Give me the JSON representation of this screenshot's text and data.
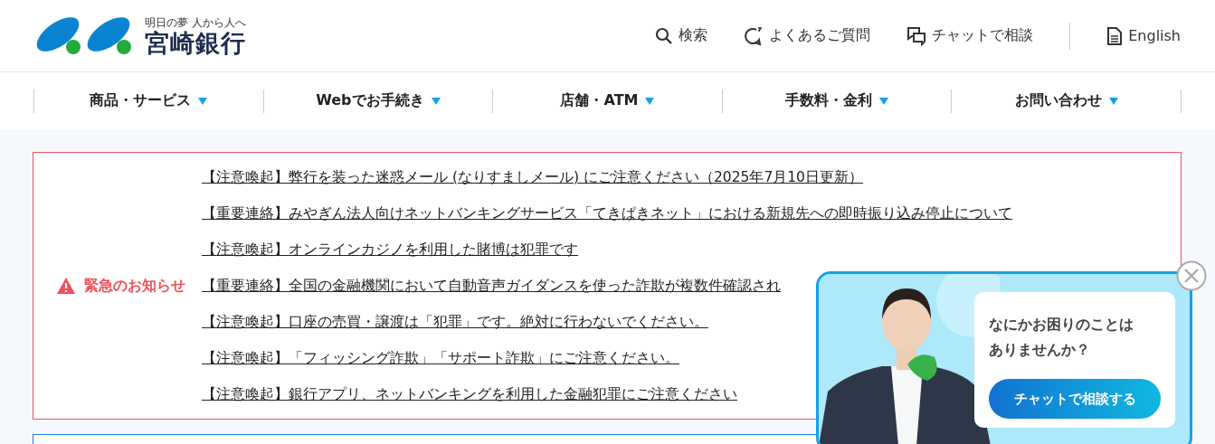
{
  "header": {
    "tagline": "明日の夢 人から人へ",
    "bank_name": "宮崎銀行",
    "utility_links": [
      {
        "kind": "search",
        "label": "検索"
      },
      {
        "kind": "faq",
        "label": "よくあるご質問"
      },
      {
        "kind": "chat",
        "label": "チャットで相談"
      },
      {
        "kind": "english",
        "label": "English"
      }
    ]
  },
  "nav": [
    {
      "label": "商品・サービス"
    },
    {
      "label": "Webでお手続き"
    },
    {
      "label": "店舗・ATM"
    },
    {
      "label": "手数料・金利"
    },
    {
      "label": "お問い合わせ"
    }
  ],
  "emergency": {
    "heading": "緊急のお知らせ",
    "notices": [
      "【注意喚起】弊行を装った迷惑メール (なりすましメール) にご注意ください（2025年7月10日更新）",
      "【重要連絡】みやぎん法人向けネットバンキングサービス「てきぱきネット」における新規先への即時振り込み停止について",
      "【注意喚起】オンラインカジノを利用した賭博は犯罪です",
      "【重要連絡】全国の金融機関において自動音声ガイダンスを使った詐欺が複数件確認され",
      "【注意喚起】口座の売買・譲渡は「犯罪」です。絶対に行わないでください。",
      "【注意喚起】「フィッシング詐欺」「サポート詐欺」にご注意ください。",
      "【注意喚起】銀行アプリ、ネットバンキングを利用した金融犯罪にご注意ください"
    ]
  },
  "chat_popup": {
    "message": "なにかお困りのことはありませんか？",
    "button": "チャットで相談する"
  }
}
